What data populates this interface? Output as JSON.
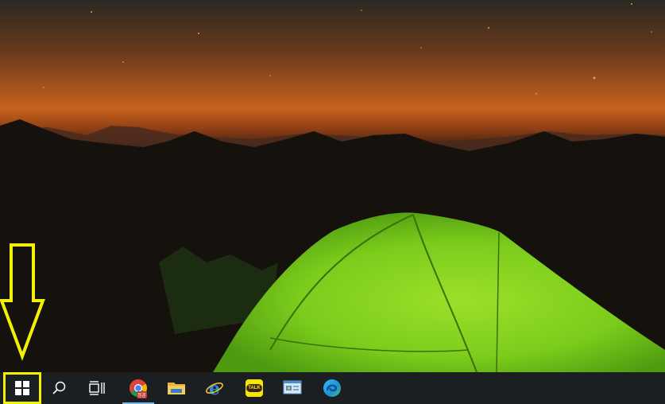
{
  "wallpaper": {
    "name": "night-camping-tent",
    "sky_top": "#2a2620",
    "sky_glow": "#c8621e",
    "tent_color": "#7fd21c"
  },
  "annotation": {
    "color": "#f2f200",
    "target": "start-button"
  },
  "taskbar": {
    "background": "#1c1f22",
    "items": [
      {
        "name": "start-button",
        "icon": "windows-logo-icon"
      },
      {
        "name": "search-button",
        "icon": "search-icon"
      },
      {
        "name": "task-view-button",
        "icon": "task-view-icon"
      },
      {
        "name": "chrome-button",
        "icon": "chrome-icon",
        "badge": "정훈",
        "active": true
      },
      {
        "name": "file-explorer-button",
        "icon": "folder-icon"
      },
      {
        "name": "internet-explorer-button",
        "icon": "internet-explorer-icon"
      },
      {
        "name": "kakaotalk-button",
        "icon": "kakaotalk-icon",
        "label": "TALK"
      },
      {
        "name": "control-panel-button",
        "icon": "control-panel-icon"
      },
      {
        "name": "edge-button",
        "icon": "edge-icon"
      }
    ]
  }
}
